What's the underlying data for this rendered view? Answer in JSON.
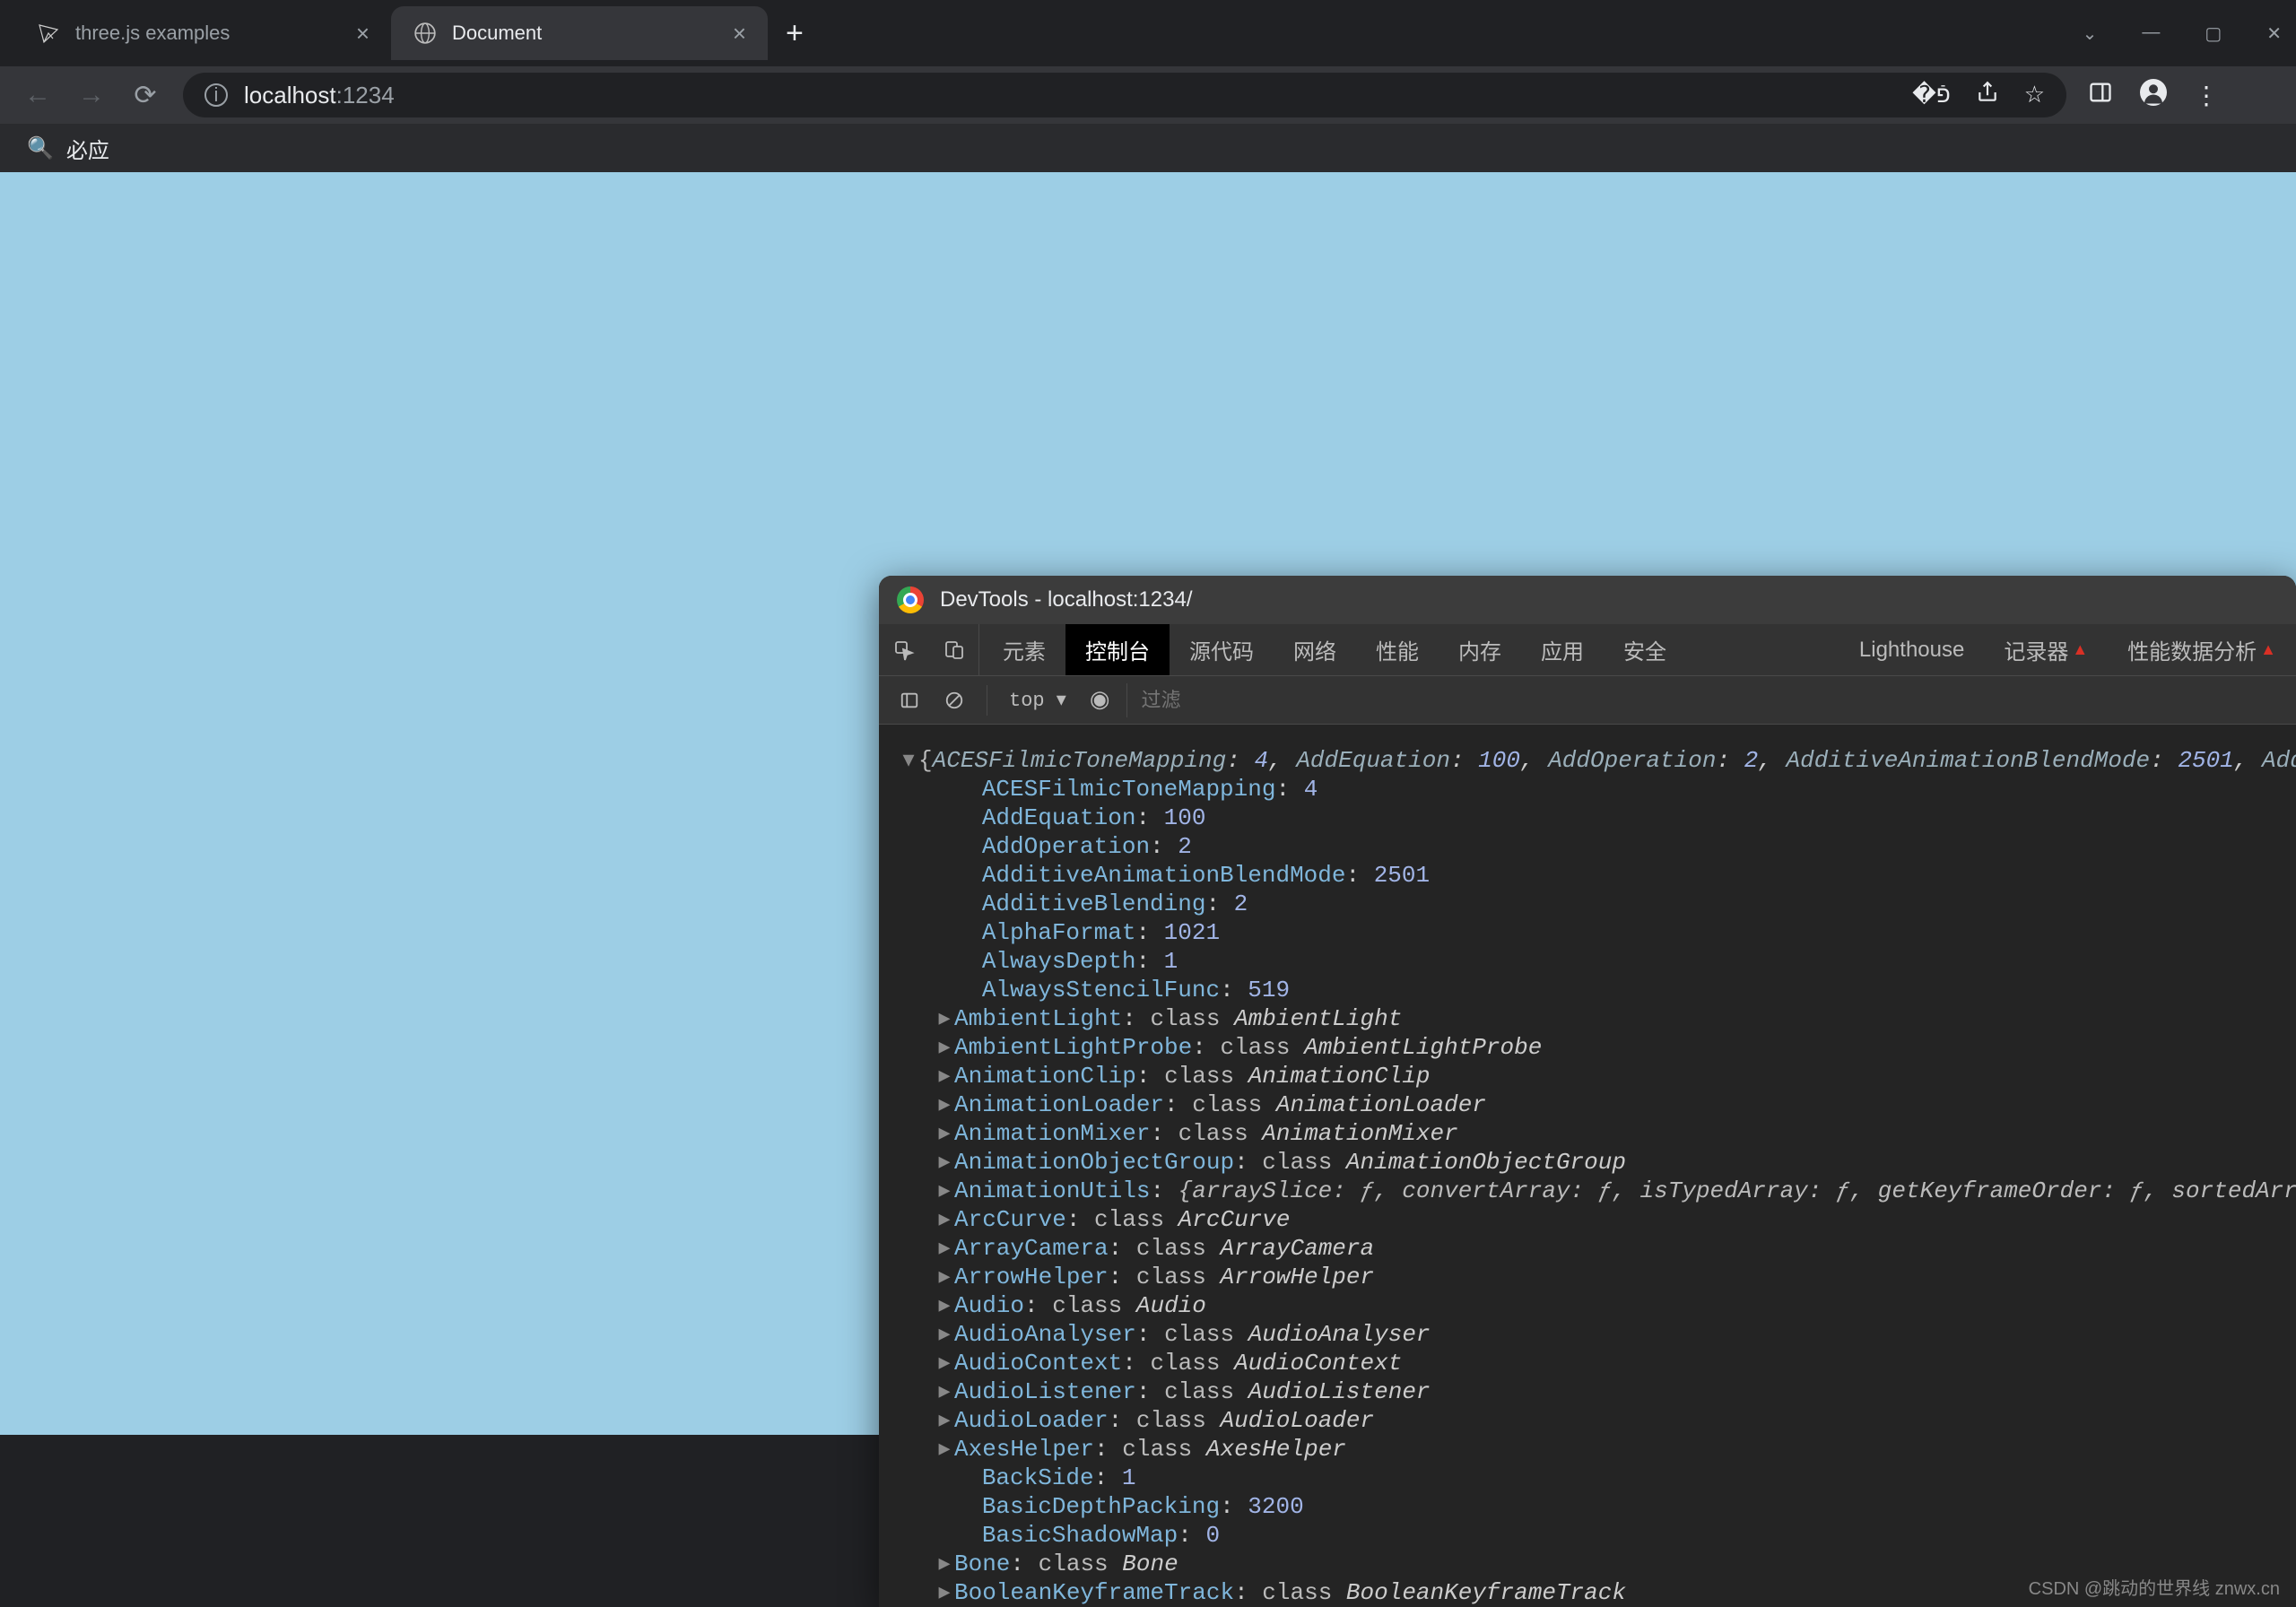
{
  "browser": {
    "tabs": [
      {
        "label": "three.js examples",
        "fav": "threejs"
      },
      {
        "label": "Document",
        "fav": "globe"
      }
    ],
    "activeTabIndex": 1,
    "window_controls": {
      "min": "—",
      "max": "▢",
      "close": "✕"
    },
    "newtab": "+",
    "addr": {
      "host": "localhost",
      "path": ":1234"
    },
    "addr_icons": [
      "translate",
      "share",
      "star"
    ],
    "right_icons": [
      "panel",
      "profile",
      "menu"
    ],
    "bookmark": {
      "label": "必应"
    }
  },
  "devtools": {
    "title": "DevTools - localhost:1234/",
    "tabs": [
      "元素",
      "控制台",
      "源代码",
      "网络",
      "性能",
      "内存",
      "应用",
      "安全"
    ],
    "tabs_right": [
      "Lighthouse",
      "记录器",
      "性能数据分析"
    ],
    "activeTab": "控制台",
    "toolbar": {
      "top": "top ▾",
      "filter_placeholder": "过滤"
    },
    "summary_pairs": [
      [
        "ACESFilmicToneMapping",
        "4"
      ],
      [
        "AddEquation",
        "100"
      ],
      [
        "AddOperation",
        "2"
      ],
      [
        "AdditiveAnimationBlendMode",
        "2501"
      ],
      [
        "AdditiveBlending",
        ""
      ]
    ],
    "numeric_props": [
      [
        "ACESFilmicToneMapping",
        "4"
      ],
      [
        "AddEquation",
        "100"
      ],
      [
        "AddOperation",
        "2"
      ],
      [
        "AdditiveAnimationBlendMode",
        "2501"
      ],
      [
        "AdditiveBlending",
        "2"
      ],
      [
        "AlphaFormat",
        "1021"
      ],
      [
        "AlwaysDepth",
        "1"
      ],
      [
        "AlwaysStencilFunc",
        "519"
      ]
    ],
    "class_props": [
      "AmbientLight",
      "AmbientLightProbe",
      "AnimationClip",
      "AnimationLoader",
      "AnimationMixer",
      "AnimationObjectGroup"
    ],
    "anim_utils_key": "AnimationUtils",
    "anim_utils_inner": "{arraySlice: ƒ, convertArray: ƒ, isTypedArray: ƒ, getKeyframeOrder: ƒ, sortedArray: ƒ, …}",
    "class_props2": [
      "ArcCurve",
      "ArrayCamera",
      "ArrowHelper",
      "Audio",
      "AudioAnalyser",
      "AudioContext",
      "AudioListener",
      "AudioLoader",
      "AxesHelper"
    ],
    "numeric_props2": [
      [
        "BackSide",
        "1"
      ],
      [
        "BasicDepthPacking",
        "3200"
      ],
      [
        "BasicShadowMap",
        "0"
      ]
    ],
    "class_props3": [
      "Bone",
      "BooleanKeyframeTrack"
    ],
    "class_kw": "class"
  },
  "watermark": "CSDN @跳动的世界线  znwx.cn"
}
